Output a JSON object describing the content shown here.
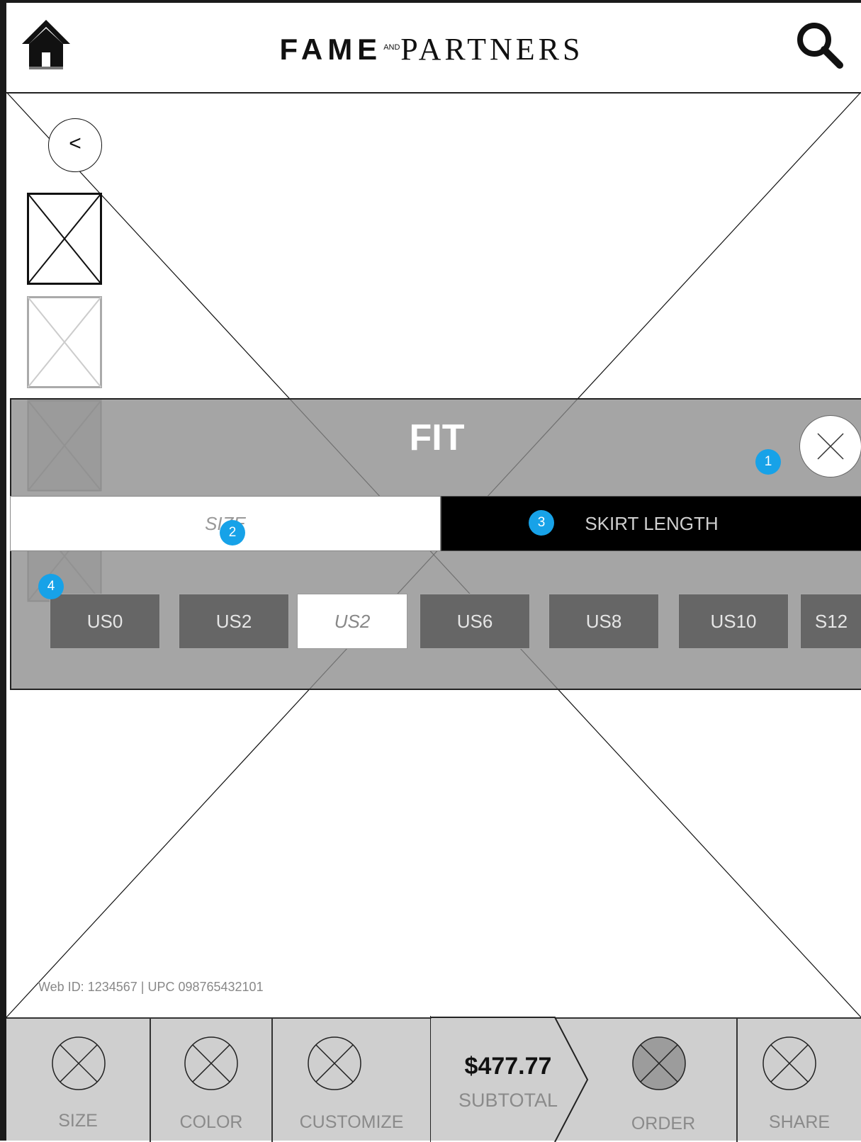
{
  "header": {
    "brand_left": "FAME",
    "brand_and": "AND",
    "brand_right": "PARTNERS",
    "home_icon": "home-icon",
    "search_icon": "search-icon"
  },
  "gallery": {
    "back_label": "<"
  },
  "fit_panel": {
    "title": "FIT",
    "close_icon": "close-icon",
    "tabs": {
      "size": "SIZE",
      "skirt_length": "SKIRT LENGTH"
    },
    "sizes": [
      "US0",
      "US2",
      "US2",
      "US6",
      "US8",
      "US10",
      "S12"
    ],
    "selected_index": 2
  },
  "annotations": {
    "badge_1": "1",
    "badge_2": "2",
    "badge_3": "3",
    "badge_4": "4",
    "color": "#17a2e8"
  },
  "product_meta": "Web ID: 1234567  |  UPC 098765432101",
  "bottom_bar": {
    "size_label": "SIZE",
    "color_label": "COLOR",
    "customize_label": "CUSTOMIZE",
    "price": "$477.77",
    "subtotal_label": "SUBTOTAL",
    "order_label": "ORDER",
    "share_label": "SHARE"
  }
}
